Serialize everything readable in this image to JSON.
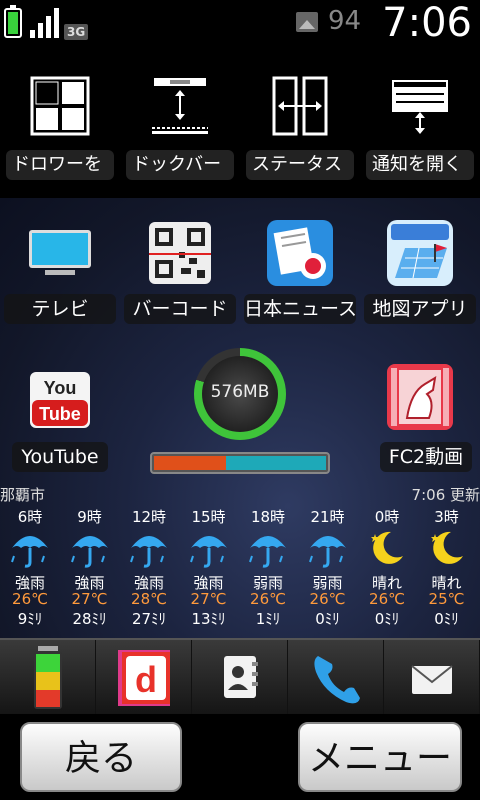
{
  "status_bar": {
    "network": "3G",
    "battery_level": 0.85,
    "photo_count": "94",
    "time": "7:06"
  },
  "toggles": [
    {
      "label": "ドロワーを",
      "icon": "drawer-grid-icon"
    },
    {
      "label": "ドックバー",
      "icon": "dock-bar-icon"
    },
    {
      "label": "ステータス",
      "icon": "status-bar-icon"
    },
    {
      "label": "通知を開く",
      "icon": "notification-icon"
    }
  ],
  "apps_row1": [
    {
      "label": "テレビ",
      "icon": "tv-icon"
    },
    {
      "label": "バーコード",
      "icon": "qr-barcode-icon"
    },
    {
      "label": "日本ニュース",
      "icon": "news-icon"
    },
    {
      "label": "地図アプリ",
      "icon": "map-icon"
    }
  ],
  "apps_row2": [
    {
      "label": "YouTube",
      "icon": "youtube-icon"
    },
    {
      "label": "FC2動画",
      "icon": "fc2-video-icon"
    }
  ],
  "memory_widget": {
    "value": "576MB",
    "bar_used_fraction": 0.42,
    "bar_free_fraction": 0.58
  },
  "weather": {
    "city": "那覇市",
    "updated": "7:06 更新",
    "forecast": [
      {
        "time": "6時",
        "cond": "強雨",
        "temp": "26℃",
        "rain": "9ﾐﾘ",
        "icon": "umbrella-icon"
      },
      {
        "time": "9時",
        "cond": "強雨",
        "temp": "27℃",
        "rain": "28ﾐﾘ",
        "icon": "umbrella-icon"
      },
      {
        "time": "12時",
        "cond": "強雨",
        "temp": "28℃",
        "rain": "27ﾐﾘ",
        "icon": "umbrella-icon"
      },
      {
        "time": "15時",
        "cond": "強雨",
        "temp": "27℃",
        "rain": "13ﾐﾘ",
        "icon": "umbrella-icon"
      },
      {
        "time": "18時",
        "cond": "弱雨",
        "temp": "26℃",
        "rain": "1ﾐﾘ",
        "icon": "umbrella-icon"
      },
      {
        "time": "21時",
        "cond": "弱雨",
        "temp": "26℃",
        "rain": "0ﾐﾘ",
        "icon": "umbrella-icon"
      },
      {
        "time": "0時",
        "cond": "晴れ",
        "temp": "26℃",
        "rain": "0ﾐﾘ",
        "icon": "moon-icon"
      },
      {
        "time": "3時",
        "cond": "晴れ",
        "temp": "25℃",
        "rain": "0ﾐﾘ",
        "icon": "moon-icon"
      }
    ]
  },
  "dock": [
    "battery-app-icon",
    "docomo-d-icon",
    "contacts-icon",
    "phone-icon",
    "mail-icon"
  ],
  "buttons": {
    "back": "戻る",
    "menu": "メニュー"
  },
  "colors": {
    "temp": "#ff9a3c",
    "umbrella": "#35a8f0",
    "moon": "#f5d21c"
  }
}
